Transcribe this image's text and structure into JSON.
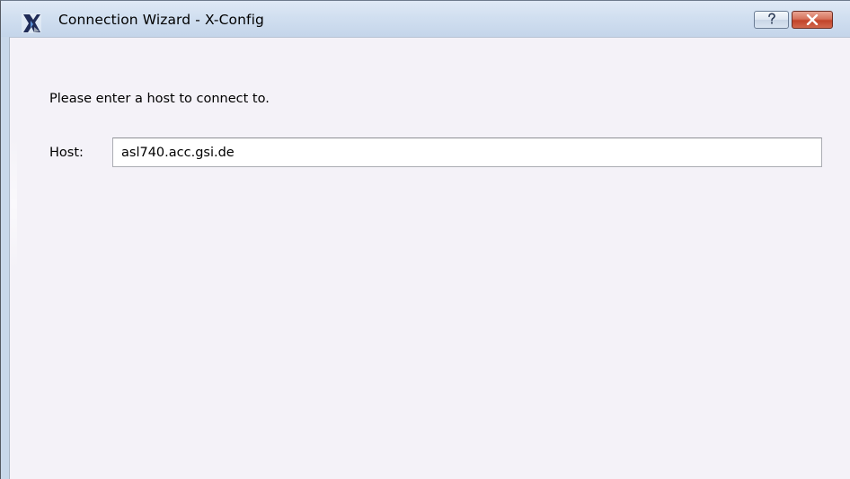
{
  "window": {
    "title": "Connection Wizard - X-Config",
    "icon": "x-config-app-icon",
    "help_label": "?",
    "close_label": "x"
  },
  "content": {
    "prompt": "Please enter a host to connect to.",
    "host_label": "Host:",
    "host_value": "asl740.acc.gsi.de",
    "host_placeholder": ""
  },
  "colors": {
    "titlebar": "#d1dff0",
    "client_background": "#f4f2f8",
    "close_button": "#c2432a",
    "input_border": "#abadb3"
  }
}
